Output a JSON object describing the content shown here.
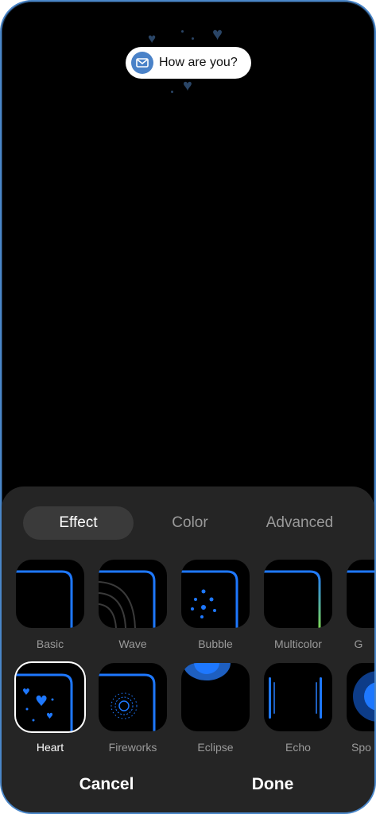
{
  "preview": {
    "notification_text": "How are you?",
    "notification_icon": "mail-icon"
  },
  "tabs": [
    {
      "label": "Effect",
      "selected": true
    },
    {
      "label": "Color",
      "selected": false
    },
    {
      "label": "Advanced",
      "selected": false
    }
  ],
  "effects_row1": [
    {
      "label": "Basic"
    },
    {
      "label": "Wave"
    },
    {
      "label": "Bubble"
    },
    {
      "label": "Multicolor"
    },
    {
      "label": "G"
    }
  ],
  "effects_row2": [
    {
      "label": "Heart",
      "selected": true
    },
    {
      "label": "Fireworks"
    },
    {
      "label": "Eclipse"
    },
    {
      "label": "Echo"
    },
    {
      "label": "Spo"
    }
  ],
  "actions": {
    "cancel": "Cancel",
    "done": "Done"
  },
  "colors": {
    "accent": "#1e78ff",
    "frame": "#4a86c8",
    "panel": "#252525",
    "multicolor_edge": "#7ed957"
  }
}
